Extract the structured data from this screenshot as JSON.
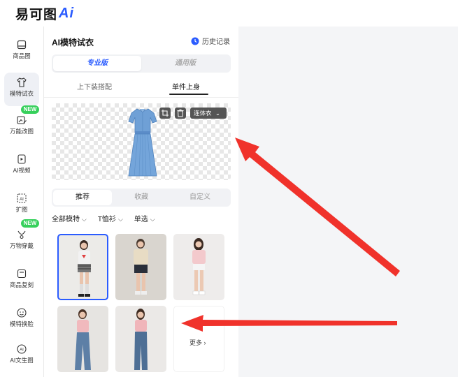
{
  "app": {
    "logo_text": "易可图",
    "logo_ai": "Ai"
  },
  "sidebar": {
    "items": [
      {
        "label": "商品图",
        "icon": "image-icon"
      },
      {
        "label": "模特试衣",
        "icon": "shirt-icon",
        "active": true
      },
      {
        "label": "万能改图",
        "icon": "edit-image-icon",
        "badge": "NEW"
      },
      {
        "label": "AI视频",
        "icon": "video-icon"
      },
      {
        "label": "扩图",
        "icon": "expand-icon"
      },
      {
        "label": "万物穿戴",
        "icon": "necklace-icon",
        "badge": "NEW"
      },
      {
        "label": "商品复刻",
        "icon": "copy-icon"
      },
      {
        "label": "模特换脸",
        "icon": "face-icon"
      },
      {
        "label": "AI文生图",
        "icon": "ai-text-icon"
      }
    ]
  },
  "panel": {
    "title": "AI模特试衣",
    "history_label": "历史记录",
    "mode_tabs": [
      "专业版",
      "通用版"
    ],
    "sub_tabs": [
      "上下装搭配",
      "单件上身"
    ],
    "preview": {
      "category_select": "连体衣"
    },
    "model_tabs": [
      "推荐",
      "收藏",
      "自定义"
    ],
    "filters": [
      {
        "label": "全部模特"
      },
      {
        "label": "T恤衫"
      },
      {
        "label": "单选"
      }
    ],
    "more_label": "更多 ›"
  },
  "colors": {
    "accent": "#2b5cff",
    "arrow": "#f0322b",
    "badge": "#36d05b"
  }
}
